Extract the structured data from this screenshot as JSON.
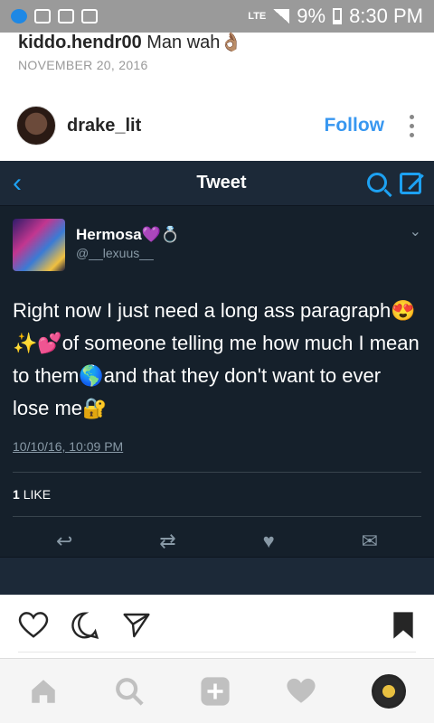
{
  "status_bar": {
    "network": "LTE",
    "battery": "9%",
    "time": "8:30 PM"
  },
  "caption": {
    "user": "kiddo.hendr00",
    "text": "Man wah👌🏽"
  },
  "post_date": "NOVEMBER 20, 2016",
  "post_header": {
    "username": "drake_lit",
    "follow_label": "Follow"
  },
  "tweet": {
    "nav_title": "Tweet",
    "author_name": "Hermosa💜💍",
    "author_handle": "@__lexuus__",
    "text": "Right now I just need a long ass paragraph😍✨💕of someone telling me how much I mean to them🌎and that they don't want to ever lose me🔐",
    "timestamp": "10/10/16, 10:09 PM",
    "likes_count": "1",
    "likes_label": "LIKE"
  },
  "colors": {
    "instagram_blue": "#3897f0",
    "twitter_blue": "#1da1f2",
    "twitter_bg": "#15202b"
  }
}
